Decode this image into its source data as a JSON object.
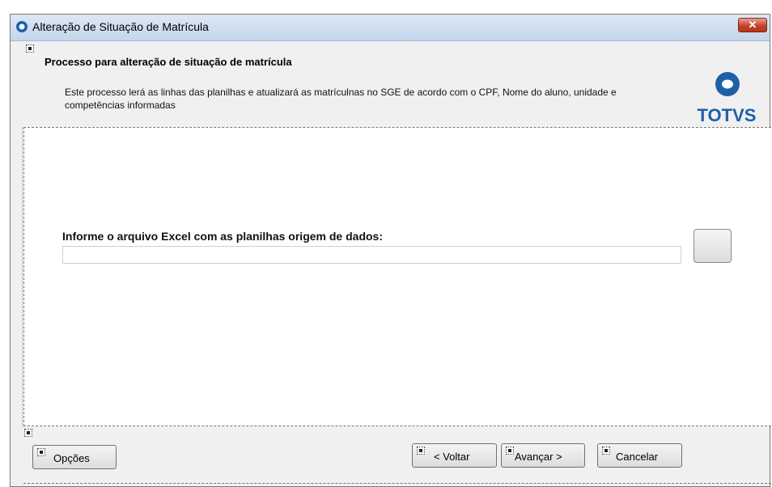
{
  "window": {
    "title": "Alteração de Situação de Matrícula",
    "close_glyph": "✕"
  },
  "header": {
    "title": "Processo para alteração de situação de matrícula",
    "description": "Este processo lerá as linhas das planilhas e atualizará as matrículnas no SGE de acordo com o CPF, Nome do aluno, unidade e competências informadas",
    "logo_text": "TOTVS"
  },
  "main": {
    "file_label": "Informe o arquivo Excel com as planilhas origem de dados:",
    "file_value": ""
  },
  "footer": {
    "options_label": "Opções",
    "back_label": "< Voltar",
    "next_label": "Avançar >",
    "cancel_label": "Cancelar"
  },
  "colors": {
    "logo_blue": "#1e5fa8",
    "close_red": "#c7432c",
    "titlebar": "#c4d6ec"
  }
}
